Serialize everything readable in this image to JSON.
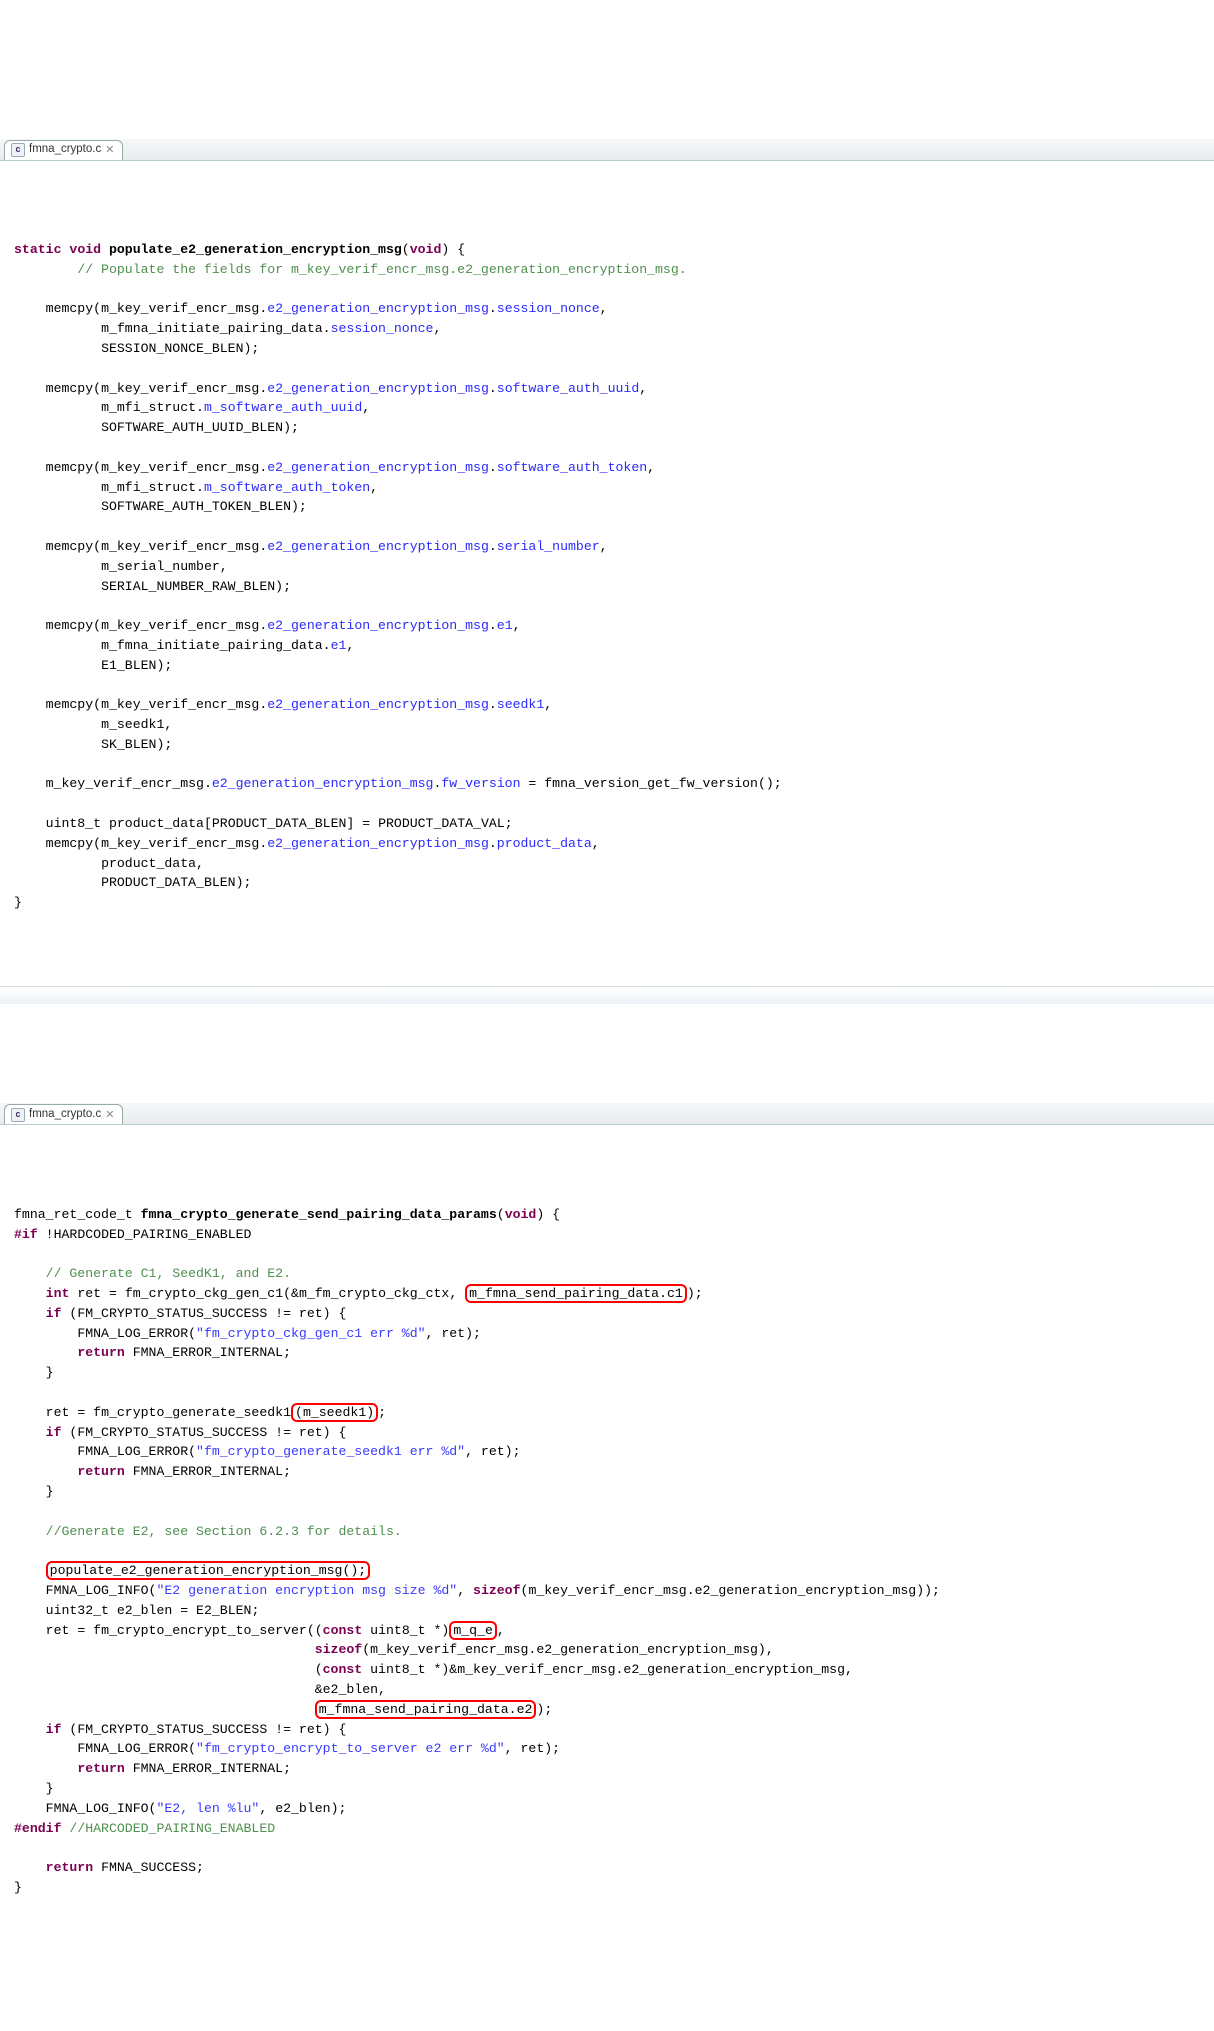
{
  "panel1": {
    "tab": {
      "filename": "fmna_crypto.c",
      "icon": "c"
    }
  },
  "panel2": {
    "tab": {
      "filename": "fmna_crypto.c",
      "icon": "c"
    }
  },
  "code1": {
    "sig_pre": "static",
    "sig_type": "void",
    "sig_fn": "populate_e2_generation_encryption_msg",
    "sig_ret": "void",
    "comment_head": "// Populate the fields for m_key_verif_encr_msg.e2_generation_encryption_msg.",
    "mc1_a": "e2_generation_encryption_msg",
    "mc1_b": "session_nonce",
    "mc1_c": "session_nonce",
    "mc1_d": "SESSION_NONCE_BLEN",
    "mc2_b": "software_auth_uuid",
    "mc2_c": "m_software_auth_uuid",
    "mc2_d": "SOFTWARE_AUTH_UUID_BLEN",
    "mc3_b": "software_auth_token",
    "mc3_c": "m_software_auth_token",
    "mc3_d": "SOFTWARE_AUTH_TOKEN_BLEN",
    "mc4_b": "serial_number",
    "mc4_c": "m_serial_number",
    "mc4_d": "SERIAL_NUMBER_RAW_BLEN",
    "mc5_b": "e1",
    "mc5_c": "e1",
    "mc5_d": "E1_BLEN",
    "mc6_b": "seedk1",
    "mc6_c": "m_seedk1",
    "mc6_d": "SK_BLEN",
    "fw_field": "fw_version",
    "fw_call": "fmna_version_get_fw_version",
    "prod_decl_type": "uint8_t",
    "prod_decl_name": "product_data",
    "prod_decl_size": "PRODUCT_DATA_BLEN",
    "prod_decl_val": "PRODUCT_DATA_VAL",
    "mc7_b": "product_data",
    "mc7_c": "product_data",
    "mc7_d": "PRODUCT_DATA_BLEN",
    "prefix_key": "m_key_verif_encr_msg",
    "prefix_pairing": "m_fmna_initiate_pairing_data",
    "prefix_mfi": "m_mfi_struct"
  },
  "code2": {
    "ret_type": "fmna_ret_code_t",
    "fn": "fmna_crypto_generate_send_pairing_data_params",
    "ret": "void",
    "ifdef": "#if",
    "ifdef_cond": "!HARDCODED_PAIRING_ENABLED",
    "cmt1": "// Generate C1, SeedK1, and E2.",
    "int_kw": "int",
    "ret_var": "ret",
    "fn_genc1": "fm_crypto_ckg_gen_c1",
    "arg_ctx": "&m_fm_crypto_ckg_ctx",
    "box_c1": "m_fmna_send_pairing_data.c1",
    "if_kw": "if",
    "success_const": "FM_CRYPTO_STATUS_SUCCESS",
    "log_err": "FMNA_LOG_ERROR",
    "err_str1": "\"fm_crypto_ckg_gen_c1 err %d\"",
    "return_kw": "return",
    "err_const": "FMNA_ERROR_INTERNAL",
    "fn_seedk1": "fm_crypto_generate_seedk1",
    "box_seedk1": "m_seedk1",
    "err_str2": "\"fm_crypto_generate_seedk1 err %d\"",
    "cmt2": "//Generate E2, see Section 6.2.3 for details.",
    "box_popcall": "populate_e2_generation_encryption_msg();",
    "log_info": "FMNA_LOG_INFO",
    "info_str1": "\"E2 generation encryption msg size %d\"",
    "sizeof_kw": "sizeof",
    "sizeof_arg": "m_key_verif_encr_msg.e2_generation_encryption_msg",
    "e2blen_type": "uint32_t",
    "e2blen_name": "e2_blen",
    "e2blen_val": "E2_BLEN",
    "fn_encrypt": "fm_crypto_encrypt_to_server",
    "const_kw": "const",
    "u8_type": "uint8_t",
    "box_mqe": "m_q_e",
    "enc_line2_sizeof": "m_key_verif_encr_msg.e2_generation_encryption_msg",
    "enc_line3_cast": "&m_key_verif_encr_msg.e2_generation_encryption_msg",
    "enc_line4": "&e2_blen",
    "box_e2": "m_fmna_send_pairing_data.e2",
    "err_str3": "\"fm_crypto_encrypt_to_server e2 err %d\"",
    "info_str2": "\"E2, len %lu\"",
    "info_arg2": "e2_blen",
    "endif": "#endif",
    "endif_cmt": "//HARCODED_PAIRING_ENABLED",
    "success_ret": "FMNA_SUCCESS"
  }
}
